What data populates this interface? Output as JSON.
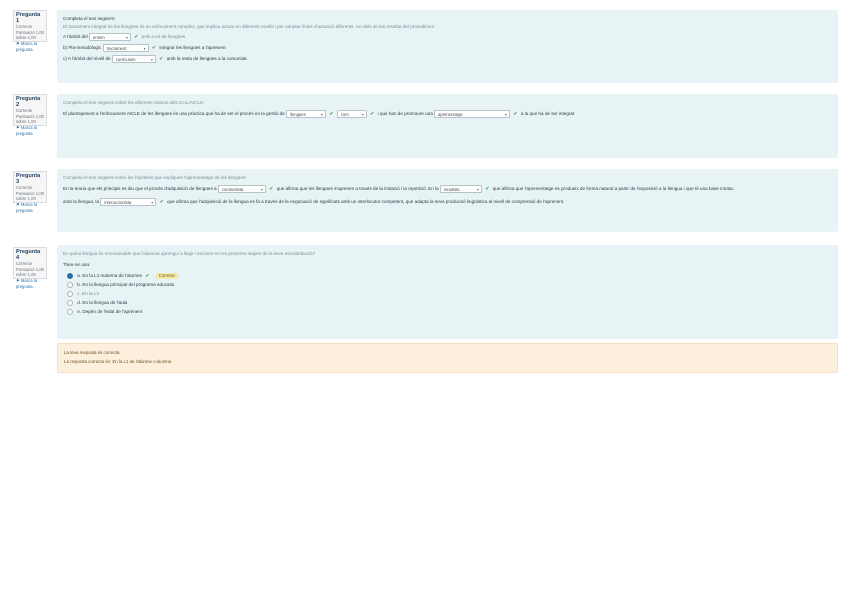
{
  "questions": [
    {
      "number": "Pregunta 1",
      "state": "Correcte",
      "score": "Puntuació 1,00 sobre 1,00",
      "flag": "Marca la pregunta",
      "title": "Completa el text següent:",
      "line1": "El tractament integral de les llengües és un enfocament complex, que implica actuar en diferents nivells i per adoptar línies d'actuació diferents. Un dels de les resultat del procedimen",
      "sel1": "entorn",
      "sel1_pre": "A l'àmbit del",
      "sel1_post": "pels a tot de llengües",
      "sel2_pre": "b) Pla-metodòlogic",
      "sel2": "tractament",
      "sel2_post": "integrar les llengües a l'aprenent",
      "sel3_pre": "c) A l'àmbit del nivell de",
      "sel3": "currículum",
      "sel3_post": "amb la resta de llengües a la comunitat."
    },
    {
      "number": "Pregunta 2",
      "state": "Correcte",
      "score": "Puntuació 1,00 sobre 1,00",
      "flag": "Marca la pregunta",
      "title": "Completa el text següent sobre les diferents visions dels CLIL/AICLE:",
      "line1_pre": "El plantejament a l'enfocament AICLE de les llengües és una pràctica que ha de ser el procés en la gestió de",
      "sel1": "llengües",
      "sel2": "com",
      "line1_mid": "i que han de promoure una",
      "sel3": "aprenentatge",
      "line1_post": "a la que ha de ser integrat",
      "feedback": ""
    },
    {
      "number": "Pregunta 3",
      "state": "Correcte",
      "score": "Puntuació 1,00 sobre 1,00",
      "flag": "Marca la pregunta",
      "title": "Completa el text següent sobre les hipòtesis que expliquen l'aprenentatge de les llengües:",
      "line1_pre": "En la teoria que els principis es diu que el procés d'adquisició de llengües a",
      "sel1": "conductista",
      "line1_mid": "que afirma que les llengües s'aprenen a través de la imitació i la repetició. En la",
      "sel2": "innatista",
      "line1_post": "que afirma que l'aprenentatge es produeix de forma natural a partir de l'exposició a la llengua i que té una base innata.",
      "line2_pre": "amb la llengua, la",
      "sel3": "interaccionista",
      "line2_post": "que afirma que l'adquisició de la llengua es fa a través de la negociació de significats amb un interlocutor competent, que adapta la seva producció lingüística al nivell de comprensió de l'aprenent."
    },
    {
      "number": "Pregunta 4",
      "state": "Correcte",
      "score": "Puntuació 1,00 sobre 1,00",
      "flag": "Marca la pregunta",
      "title": "En quina llengua és recomanable que l'alumnat aprengui a llegir i escriure en les primeres etapes de la seva escolarització?",
      "prompt": "Trieu-ne una:",
      "options": [
        {
          "letter": "a.",
          "text": "En la L1 materna de l'alumne",
          "selected": true,
          "tag": "Correcte"
        },
        {
          "letter": "b.",
          "text": "En la llengua principal del programa educatiu",
          "selected": false
        },
        {
          "letter": "c.",
          "text": "En la L2",
          "selected": false
        },
        {
          "letter": "d.",
          "text": "En la llengua de l'aula",
          "selected": false
        },
        {
          "letter": "e.",
          "text": "Depèn de l'edat de l'aprenent",
          "selected": false
        }
      ],
      "feedback_line1": "La teva resposta és correcta.",
      "feedback_line2": "La resposta correcta és: En la L1 de l'alumne o alumna"
    }
  ],
  "colors": {
    "question_bg": "#e7f3f5",
    "feedback_bg": "#fcefdc",
    "correct": "#3a8c3a",
    "tag_bg": "#f4e9a8"
  }
}
